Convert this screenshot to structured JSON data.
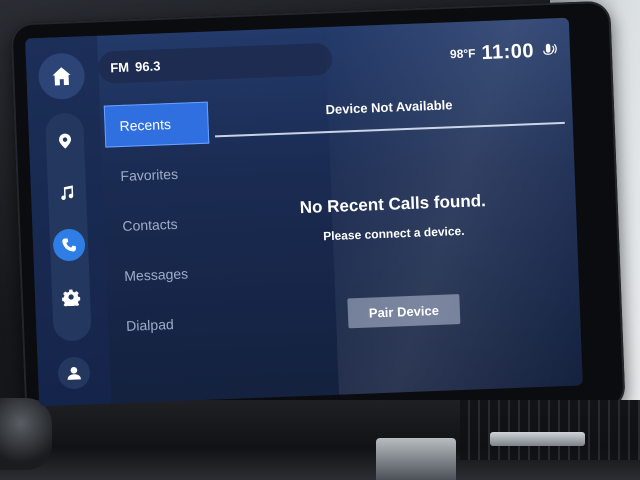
{
  "status_bar": {
    "radio_band": "FM",
    "radio_station": "96.3",
    "temperature": "98°F",
    "time": "11:00"
  },
  "rail": {
    "items": [
      {
        "icon": "home-icon"
      },
      {
        "icon": "location-pin-icon"
      },
      {
        "icon": "music-note-icon"
      },
      {
        "icon": "phone-icon",
        "active": true
      },
      {
        "icon": "gear-icon"
      },
      {
        "icon": "user-icon"
      }
    ]
  },
  "tabs": [
    {
      "label": "Recents",
      "active": true
    },
    {
      "label": "Favorites"
    },
    {
      "label": "Contacts"
    },
    {
      "label": "Messages"
    },
    {
      "label": "Dialpad"
    }
  ],
  "content": {
    "header": "Device Not Available",
    "message_title": "No Recent Calls found.",
    "message_sub": "Please connect a device.",
    "pair_button": "Pair Device"
  },
  "colors": {
    "screen_bg": "#1a2b52",
    "active_accent": "#2f6fe0",
    "button_bg": "#6c7895"
  }
}
